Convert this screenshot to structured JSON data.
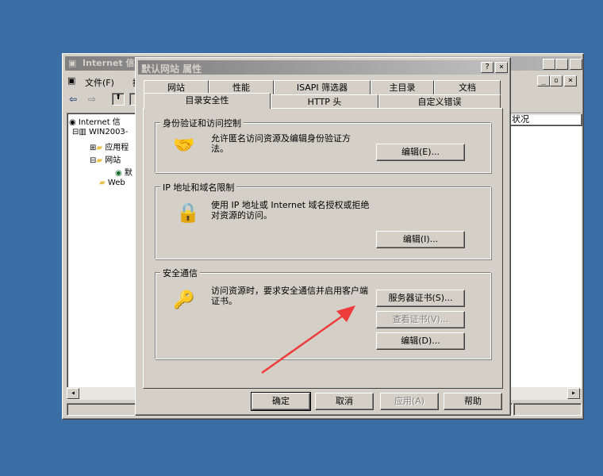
{
  "mmc": {
    "title": "Internet 信",
    "menu_file": "文件(F)",
    "menu_action": "操",
    "tree": [
      "Internet 信",
      "WIN2003-",
      "应用程",
      "网站",
      "默",
      "Web"
    ],
    "list_header": "状况"
  },
  "dialog": {
    "title": "默认网站 属性",
    "help_btn": "?",
    "close_btn": "×",
    "tabs_row1": [
      "网站",
      "性能",
      "ISAPI 筛选器",
      "主目录",
      "文档"
    ],
    "tabs_row2": [
      "目录安全性",
      "HTTP 头",
      "自定义错误"
    ],
    "groups": {
      "auth": {
        "label": "身份验证和访问控制",
        "text": "允许匿名访问资源及编辑身份验证方法。",
        "edit": "编辑(E)..."
      },
      "ip": {
        "label": "IP 地址和域名限制",
        "text": "使用 IP 地址或 Internet 域名授权或拒绝对资源的访问。",
        "edit": "编辑(I)..."
      },
      "secure": {
        "label": "安全通信",
        "text": "访问资源时，要求安全通信并启用客户端证书。",
        "server_cert": "服务器证书(S)...",
        "view_cert": "查看证书(V)...",
        "edit": "编辑(D)..."
      }
    },
    "buttons": {
      "ok": "确定",
      "cancel": "取消",
      "apply": "应用(A)",
      "help": "帮助"
    }
  },
  "colors": {
    "desktop": "#3a6ea5",
    "face": "#d4d0c8",
    "arrow": "#ee3b3b"
  }
}
